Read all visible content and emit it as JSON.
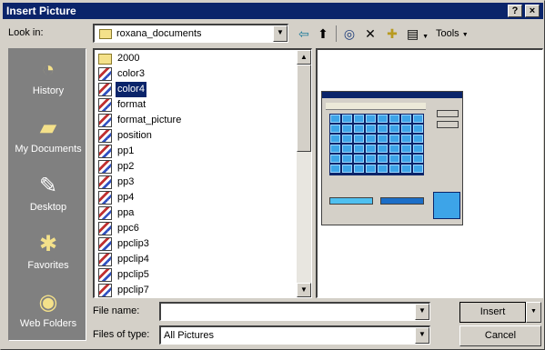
{
  "window": {
    "title": "Insert Picture",
    "help_glyph": "?",
    "close_glyph": "×"
  },
  "look_in": {
    "label": "Look in:",
    "value": "roxana_documents"
  },
  "toolbar": {
    "back_glyph": "⇦",
    "up_glyph": "⬆",
    "search_glyph": "◎",
    "delete_glyph": "✕",
    "newfolder_glyph": "✚",
    "views_glyph": "▤",
    "tools_label": "Tools"
  },
  "places": [
    {
      "label": "History",
      "icon": "history-folder-icon",
      "glyph": "◔"
    },
    {
      "label": "My Documents",
      "icon": "my-documents-folder-icon",
      "glyph": "▰"
    },
    {
      "label": "Desktop",
      "icon": "desktop-icon",
      "glyph": "✎"
    },
    {
      "label": "Favorites",
      "icon": "favorites-folder-icon",
      "glyph": "✱"
    },
    {
      "label": "Web Folders",
      "icon": "web-folders-icon",
      "glyph": "◉"
    }
  ],
  "files": [
    {
      "name": "2000",
      "type": "folder"
    },
    {
      "name": "color3",
      "type": "image"
    },
    {
      "name": "color4",
      "type": "image",
      "selected": true
    },
    {
      "name": "format",
      "type": "image"
    },
    {
      "name": "format_picture",
      "type": "image"
    },
    {
      "name": "position",
      "type": "image"
    },
    {
      "name": "pp1",
      "type": "image"
    },
    {
      "name": "pp2",
      "type": "image"
    },
    {
      "name": "pp3",
      "type": "image"
    },
    {
      "name": "pp4",
      "type": "image"
    },
    {
      "name": "ppa",
      "type": "image"
    },
    {
      "name": "ppc6",
      "type": "image"
    },
    {
      "name": "ppclip3",
      "type": "image"
    },
    {
      "name": "ppclip4",
      "type": "image"
    },
    {
      "name": "ppclip5",
      "type": "image"
    },
    {
      "name": "ppclip7",
      "type": "image"
    }
  ],
  "file_name": {
    "label": "File name:",
    "value": ""
  },
  "files_of_type": {
    "label": "Files of type:",
    "value": "All Pictures"
  },
  "buttons": {
    "insert": "Insert",
    "cancel": "Cancel"
  },
  "colors": {
    "title_bar": "#0a246a",
    "selection": "#0a246a",
    "places_bg": "#808080",
    "dialog_bg": "#d4d0c8"
  }
}
